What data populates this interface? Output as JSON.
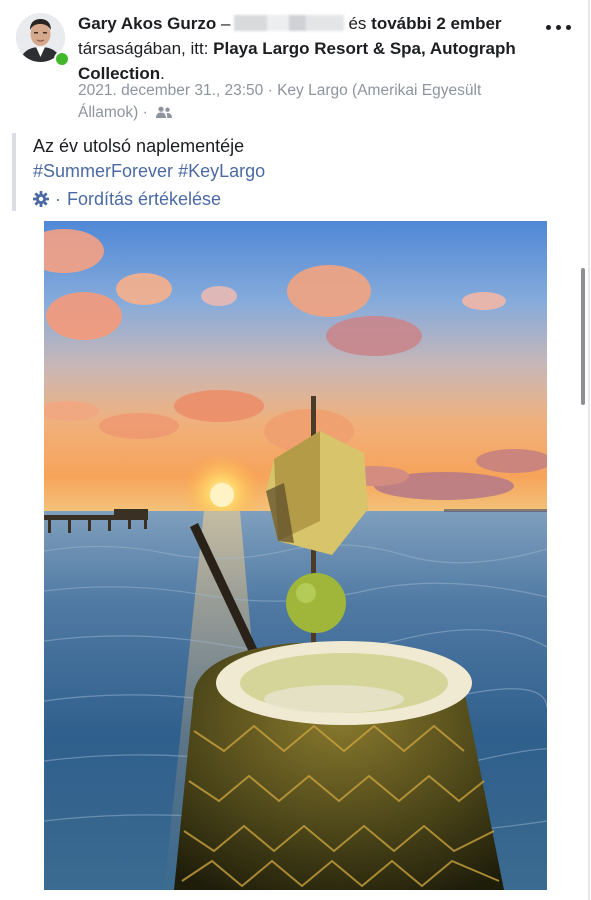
{
  "post": {
    "author": "Gary Akos Gurzo",
    "dash": "–",
    "tagged_conj": "és",
    "others": "további 2 ember",
    "with_text": "társaságában, itt:",
    "place": "Playa Largo Resort & Spa, Autograph Collection",
    "period": ".",
    "timestamp": "2021. december 31., 23:50",
    "separator": "·",
    "location": "Key Largo (Amerikai Egyesült Államok)",
    "text": "Az év utolsó naplementéje",
    "hashtags": [
      "#SummerForever",
      "#KeyLargo"
    ],
    "translate_label": "Fordítás értékelése"
  },
  "colors": {
    "link": "#4b6aa3",
    "meta": "#8d949e",
    "online": "#42b72a"
  },
  "icons": [
    "gear-icon",
    "friends-audience-icon",
    "more-options-icon"
  ]
}
